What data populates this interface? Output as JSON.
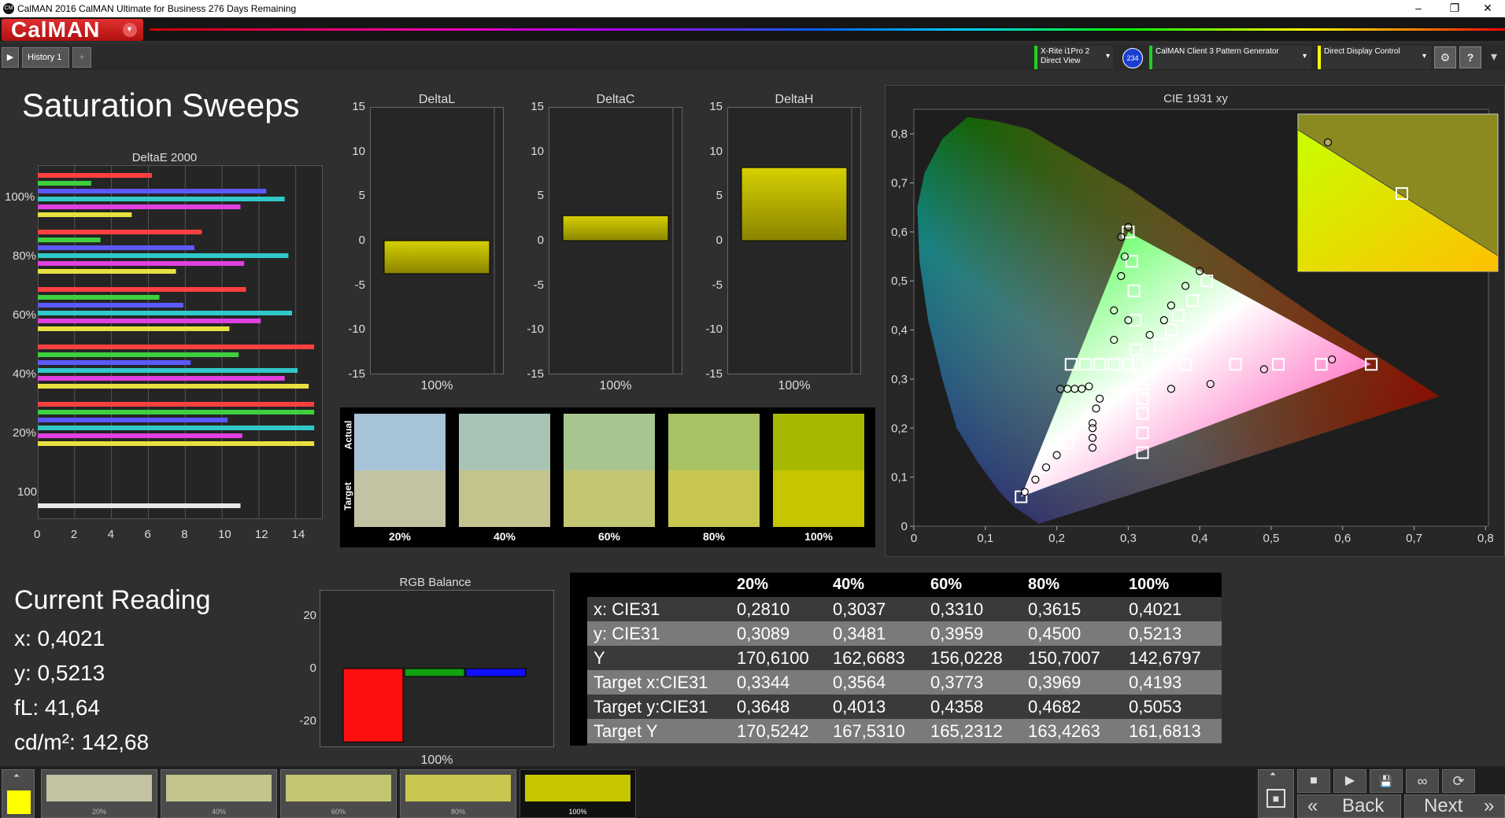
{
  "window": {
    "title": "CalMAN 2016 CalMAN Ultimate for Business 276 Days Remaining",
    "logo_text": "CM",
    "minimize": "–",
    "restore": "❐",
    "close": "✕"
  },
  "header": {
    "app_button": "CalMAN",
    "app_button_arrow": "▾"
  },
  "toolbar": {
    "play_icon": "▶",
    "history_tab": "History 1",
    "add_tab": "+",
    "meter": {
      "line1": "X-Rite i1Pro 2",
      "line2": "Direct View",
      "badge": "234"
    },
    "generator": "CalMAN Client 3 Pattern Generator",
    "display": "Direct Display Control",
    "dropdown_arrow": "▾",
    "settings_icon": "⚙",
    "help_icon": "?",
    "more_icon": "▾"
  },
  "page_title": "Saturation Sweeps",
  "colors": {
    "accent_red": "#c8102e",
    "bar_yellow": "#c8c400",
    "target_yellow": "#ffff00"
  },
  "deltae_chart": {
    "title": "DeltaE 2000",
    "y_labels": [
      "100%",
      "80%",
      "60%",
      "40%",
      "20%",
      "100"
    ],
    "x_ticks": [
      "0",
      "2",
      "4",
      "6",
      "8",
      "10",
      "12",
      "14"
    ]
  },
  "delta_charts": {
    "y_ticks": [
      "15",
      "10",
      "5",
      "0",
      "-5",
      "-10",
      "-15"
    ]
  },
  "chart_data": [
    {
      "type": "bar",
      "title": "DeltaE 2000",
      "orientation": "horizontal",
      "xlim": [
        0,
        15
      ],
      "groups": [
        {
          "label": "100%",
          "values": [
            6.2,
            2.9,
            12.4,
            13.4,
            11.0,
            5.1
          ]
        },
        {
          "label": "80%",
          "values": [
            8.9,
            3.4,
            8.5,
            13.6,
            11.2,
            7.5
          ]
        },
        {
          "label": "60%",
          "values": [
            11.3,
            6.6,
            7.9,
            13.8,
            12.1,
            10.4
          ]
        },
        {
          "label": "40%",
          "values": [
            15.0,
            10.9,
            8.3,
            14.1,
            13.4,
            14.7
          ]
        },
        {
          "label": "20%",
          "values": [
            15.0,
            15.0,
            10.3,
            15.0,
            11.1,
            15.0
          ]
        },
        {
          "label": "100",
          "values": [
            11.0
          ]
        }
      ],
      "colors": [
        "#ff4040",
        "#3fd03f",
        "#5a5aff",
        "#30c8c8",
        "#e040e0",
        "#e8e040"
      ]
    },
    {
      "type": "bar",
      "title": "DeltaL",
      "categories": [
        "100%"
      ],
      "values": [
        -3.7
      ],
      "ylim": [
        -15,
        15
      ]
    },
    {
      "type": "bar",
      "title": "DeltaC",
      "categories": [
        "100%"
      ],
      "values": [
        2.8
      ],
      "ylim": [
        -15,
        15
      ]
    },
    {
      "type": "bar",
      "title": "DeltaH",
      "categories": [
        "100%"
      ],
      "values": [
        8.2
      ],
      "ylim": [
        -15,
        15
      ]
    },
    {
      "type": "bar",
      "title": "RGB Balance",
      "categories": [
        "100%"
      ],
      "series": [
        {
          "values": [
            -28
          ]
        },
        {
          "values": [
            -3
          ]
        },
        {
          "values": [
            -3
          ]
        }
      ],
      "ylim": [
        -30,
        30
      ],
      "y_ticks": [
        "20",
        "0",
        "-20"
      ]
    },
    {
      "type": "scatter",
      "title": "CIE 1931 xy",
      "xlim": [
        0,
        0.8
      ],
      "ylim": [
        0,
        0.85
      ],
      "x_ticks": [
        "0",
        "0,1",
        "0,2",
        "0,3",
        "0,4",
        "0,5",
        "0,6",
        "0,7",
        "0,8"
      ],
      "y_ticks": [
        "0",
        "0,1",
        "0,2",
        "0,3",
        "0,4",
        "0,5",
        "0,6",
        "0,7",
        "0,8"
      ],
      "targets": [
        [
          0.64,
          0.33
        ],
        [
          0.57,
          0.33
        ],
        [
          0.51,
          0.33
        ],
        [
          0.45,
          0.33
        ],
        [
          0.38,
          0.33
        ],
        [
          0.3127,
          0.329
        ],
        [
          0.3,
          0.6
        ],
        [
          0.305,
          0.54
        ],
        [
          0.308,
          0.48
        ],
        [
          0.31,
          0.42
        ],
        [
          0.311,
          0.36
        ],
        [
          0.15,
          0.06
        ],
        [
          0.18,
          0.12
        ],
        [
          0.215,
          0.17
        ],
        [
          0.245,
          0.215
        ],
        [
          0.28,
          0.27
        ],
        [
          0.41,
          0.5
        ],
        [
          0.39,
          0.46
        ],
        [
          0.37,
          0.43
        ],
        [
          0.36,
          0.4
        ],
        [
          0.345,
          0.37
        ],
        [
          0.22,
          0.33
        ],
        [
          0.24,
          0.33
        ],
        [
          0.26,
          0.33
        ],
        [
          0.28,
          0.33
        ],
        [
          0.3,
          0.33
        ],
        [
          0.32,
          0.15
        ],
        [
          0.32,
          0.19
        ],
        [
          0.32,
          0.23
        ],
        [
          0.32,
          0.26
        ],
        [
          0.32,
          0.29
        ]
      ],
      "measured": [
        [
          0.585,
          0.34
        ],
        [
          0.49,
          0.32
        ],
        [
          0.415,
          0.29
        ],
        [
          0.36,
          0.28
        ],
        [
          0.3,
          0.61
        ],
        [
          0.29,
          0.59
        ],
        [
          0.295,
          0.55
        ],
        [
          0.29,
          0.51
        ],
        [
          0.28,
          0.44
        ],
        [
          0.3,
          0.42
        ],
        [
          0.28,
          0.38
        ],
        [
          0.155,
          0.07
        ],
        [
          0.17,
          0.095
        ],
        [
          0.185,
          0.12
        ],
        [
          0.2,
          0.145
        ],
        [
          0.25,
          0.21
        ],
        [
          0.4,
          0.52
        ],
        [
          0.38,
          0.49
        ],
        [
          0.36,
          0.45
        ],
        [
          0.35,
          0.42
        ],
        [
          0.33,
          0.39
        ],
        [
          0.205,
          0.28
        ],
        [
          0.215,
          0.28
        ],
        [
          0.225,
          0.28
        ],
        [
          0.235,
          0.28
        ],
        [
          0.245,
          0.285
        ],
        [
          0.25,
          0.16
        ],
        [
          0.25,
          0.18
        ],
        [
          0.25,
          0.2
        ],
        [
          0.255,
          0.24
        ],
        [
          0.26,
          0.26
        ]
      ]
    }
  ],
  "swatch_panel": {
    "actual_label": "Actual",
    "target_label": "Target",
    "items": [
      {
        "label": "20%",
        "actual": "#a7c3d8",
        "target": "#c3c3a4"
      },
      {
        "label": "40%",
        "actual": "#a9c4b5",
        "target": "#c3c48d"
      },
      {
        "label": "60%",
        "actual": "#a8c58f",
        "target": "#c4c672"
      },
      {
        "label": "80%",
        "actual": "#a6c263",
        "target": "#c7c74f"
      },
      {
        "label": "100%",
        "actual": "#a6b800",
        "target": "#c5c500"
      }
    ]
  },
  "current_reading": {
    "title": "Current Reading",
    "x": "x: 0,4021",
    "y": "y: 0,5213",
    "fl": "fL: 41,64",
    "cdm2": "cd/m²: 142,68"
  },
  "rgb_balance": {
    "title": "RGB Balance",
    "x_label": "100%"
  },
  "table": {
    "headers": [
      "20%",
      "40%",
      "60%",
      "80%",
      "100%"
    ],
    "rows": [
      {
        "label": "x: CIE31",
        "values": [
          "0,2810",
          "0,3037",
          "0,3310",
          "0,3615",
          "0,4021"
        ]
      },
      {
        "label": "y: CIE31",
        "values": [
          "0,3089",
          "0,3481",
          "0,3959",
          "0,4500",
          "0,5213"
        ]
      },
      {
        "label": "Y",
        "values": [
          "170,6100",
          "162,6683",
          "156,0228",
          "150,7007",
          "142,6797"
        ]
      },
      {
        "label": "Target x:CIE31",
        "values": [
          "0,3344",
          "0,3564",
          "0,3773",
          "0,3969",
          "0,4193"
        ]
      },
      {
        "label": "Target y:CIE31",
        "values": [
          "0,3648",
          "0,4013",
          "0,4358",
          "0,4682",
          "0,5053"
        ]
      },
      {
        "label": "Target Y",
        "values": [
          "170,5242",
          "167,5310",
          "165,2312",
          "163,4263",
          "161,6813"
        ]
      }
    ]
  },
  "bottom": {
    "swatches": [
      {
        "label": "20%",
        "color": "#c3c3a4"
      },
      {
        "label": "40%",
        "color": "#c3c48d"
      },
      {
        "label": "60%",
        "color": "#c4c672"
      },
      {
        "label": "80%",
        "color": "#c7c74f"
      },
      {
        "label": "100%",
        "color": "#c5c500"
      }
    ],
    "current_color": "#ffff00",
    "back": "Back",
    "next": "Next",
    "back_icon": "«",
    "next_icon": "»",
    "up_icon": "⏶",
    "stop_icon": "■",
    "play_icon": "▶",
    "save_icon": "💾",
    "loop_icon": "∞",
    "refresh_icon": "⟳"
  }
}
